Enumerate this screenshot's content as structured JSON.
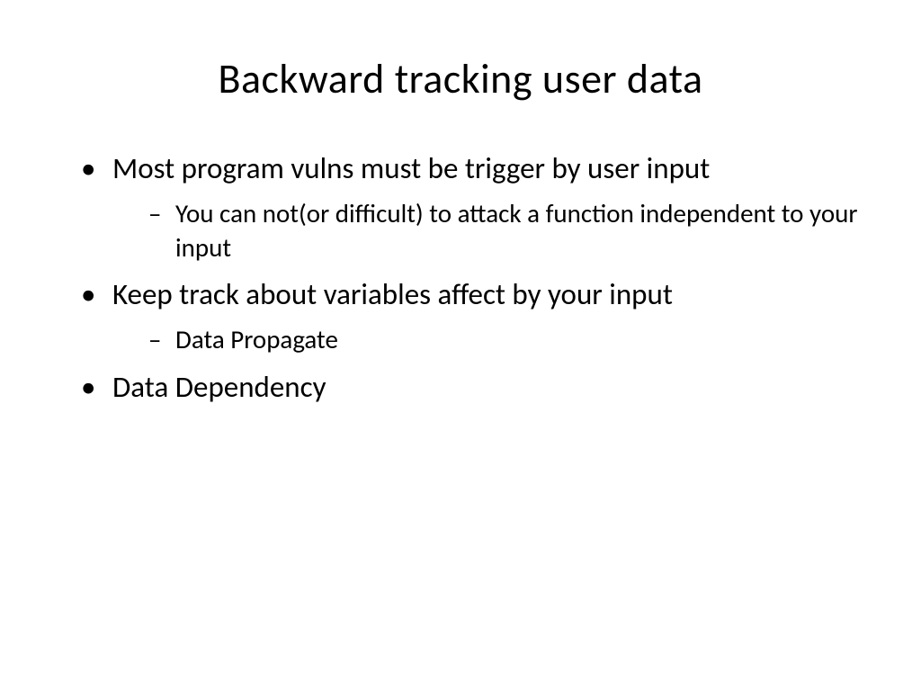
{
  "slide": {
    "title": "Backward tracking user data",
    "bullets": [
      {
        "text": "Most program vulns must be trigger by user input",
        "sub": [
          "You can not(or difficult) to attack a function independent to your input"
        ]
      },
      {
        "text": "Keep track about variables affect by your input",
        "sub": [
          "Data Propagate"
        ]
      },
      {
        "text": "Data Dependency",
        "sub": []
      }
    ]
  }
}
